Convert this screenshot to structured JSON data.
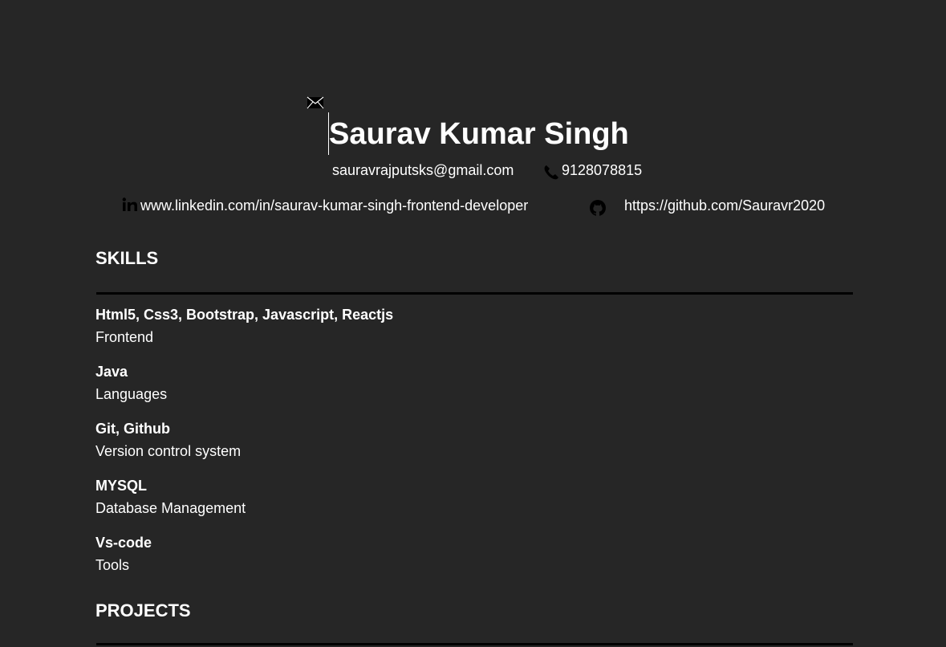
{
  "header": {
    "name": "Saurav Kumar Singh",
    "email": "sauravrajputsks@gmail.com",
    "phone": "9128078815",
    "linkedin": "www.linkedin.com/in/saurav-kumar-singh-frontend-developer",
    "github": "https://github.com/Sauravr2020",
    "icons": [
      "mail-icon",
      "phone-icon",
      "linkedin-icon",
      "github-icon"
    ]
  },
  "sections": {
    "skills_title": "SKILLS",
    "projects_title": "PROJECTS"
  },
  "skills": [
    {
      "name": "Html5, Css3, Bootstrap, Javascript, Reactjs",
      "desc": "Frontend"
    },
    {
      "name": "Java",
      "desc": "Languages"
    },
    {
      "name": "Git, Github",
      "desc": "Version control system"
    },
    {
      "name": "MYSQL",
      "desc": "Database Management"
    },
    {
      "name": "Vs-code",
      "desc": "Tools"
    }
  ],
  "colors": {
    "background": "#262626",
    "text": "#ffffff",
    "rule": "#000000"
  }
}
